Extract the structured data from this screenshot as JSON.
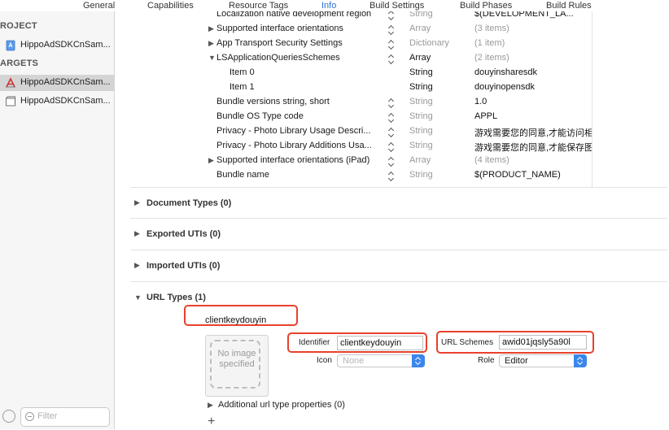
{
  "tabs": [
    "General",
    "Capabilities",
    "Resource Tags",
    "Info",
    "Build Settings",
    "Build Phases",
    "Build Rules"
  ],
  "active_tab": "Info",
  "sidebar": {
    "project_header": "ROJECT",
    "project_item": "HippoAdSDKCnSam...",
    "targets_header": "ARGETS",
    "targets": [
      {
        "label": "HippoAdSDKCnSam...",
        "icon": "app-target-icon",
        "selected": true
      },
      {
        "label": "HippoAdSDKCnSam...",
        "icon": "test-bundle-icon",
        "selected": false
      }
    ],
    "filter_placeholder": "Filter"
  },
  "plist": {
    "rows": [
      {
        "key": "Localization native development region",
        "type": "String",
        "value": "$(DEVELOPMENT_LA...",
        "expand": "",
        "indent": 0,
        "type_dark": false,
        "value_grey": false
      },
      {
        "key": "Supported interface orientations",
        "type": "Array",
        "value": "(3 items)",
        "expand": "right",
        "indent": 0,
        "type_dark": false,
        "value_grey": true
      },
      {
        "key": "App Transport Security Settings",
        "type": "Dictionary",
        "value": "(1 item)",
        "expand": "right",
        "indent": 0,
        "type_dark": false,
        "value_grey": true
      },
      {
        "key": "LSApplicationQueriesSchemes",
        "type": "Array",
        "value": "(2 items)",
        "expand": "down",
        "indent": 0,
        "type_dark": true,
        "value_grey": true
      },
      {
        "key": "Item 0",
        "type": "String",
        "value": "douyinsharesdk",
        "expand": "",
        "indent": 1,
        "type_dark": true,
        "value_grey": false
      },
      {
        "key": "Item 1",
        "type": "String",
        "value": "douyinopensdk",
        "expand": "",
        "indent": 1,
        "type_dark": true,
        "value_grey": false
      },
      {
        "key": "Bundle versions string, short",
        "type": "String",
        "value": "1.0",
        "expand": "",
        "indent": 0,
        "type_dark": false,
        "value_grey": false
      },
      {
        "key": "Bundle OS Type code",
        "type": "String",
        "value": "APPL",
        "expand": "",
        "indent": 0,
        "type_dark": false,
        "value_grey": false
      },
      {
        "key": "Privacy - Photo Library Usage Descri...",
        "type": "String",
        "value": "游戏需要您的同意,才能访问相",
        "expand": "",
        "indent": 0,
        "type_dark": false,
        "value_grey": false
      },
      {
        "key": "Privacy - Photo Library Additions Usa...",
        "type": "String",
        "value": "游戏需要您的同意,才能保存图",
        "expand": "",
        "indent": 0,
        "type_dark": false,
        "value_grey": false
      },
      {
        "key": "Supported interface orientations (iPad)",
        "type": "Array",
        "value": "(4 items)",
        "expand": "right",
        "indent": 0,
        "type_dark": false,
        "value_grey": true
      },
      {
        "key": "Bundle name",
        "type": "String",
        "value": "$(PRODUCT_NAME)",
        "expand": "",
        "indent": 0,
        "type_dark": false,
        "value_grey": false
      }
    ]
  },
  "sections": {
    "document_types": "Document Types (0)",
    "exported_utis": "Exported UTIs (0)",
    "imported_utis": "Imported UTIs (0)",
    "url_types": "URL Types (1)"
  },
  "url_type": {
    "name": "clientkeydouyin",
    "image_placeholder": "No image specified",
    "identifier_label": "Identifier",
    "identifier_value": "clientkeydouyin",
    "icon_label": "Icon",
    "icon_value": "None",
    "url_schemes_label": "URL Schemes",
    "url_schemes_value": "awid01jqsly5a90l",
    "role_label": "Role",
    "role_value": "Editor",
    "additional": "Additional url type properties (0)",
    "add_symbol": "+"
  },
  "colors": {
    "accent": "#2a73d9",
    "highlight_red": "#e8412c",
    "popup_blue": "#3a86ec"
  }
}
